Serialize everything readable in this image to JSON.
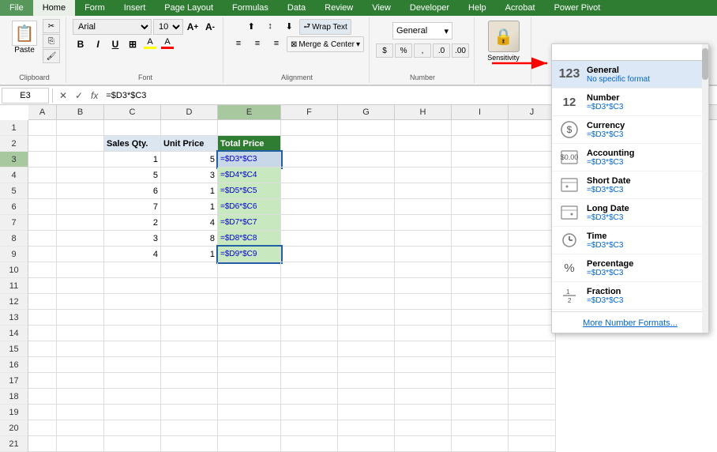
{
  "ribbon": {
    "tabs": [
      "File",
      "Home",
      "Form",
      "Insert",
      "Page Layout",
      "Formulas",
      "Data",
      "Review",
      "View",
      "Developer",
      "Help",
      "Acrobat",
      "Power Pivot"
    ],
    "active_tab": "Home",
    "groups": {
      "clipboard": {
        "label": "Clipboard",
        "paste_label": "Paste"
      },
      "font": {
        "label": "Font",
        "font_name": "Arial",
        "font_size": "10",
        "bold": "B",
        "italic": "I",
        "underline": "U"
      },
      "alignment": {
        "label": "Alignment",
        "wrap_text": "Wrap Text",
        "merge_center": "Merge & Center"
      },
      "number": {
        "label": "Number"
      },
      "sensitivity": {
        "label": "Sensitivity"
      }
    }
  },
  "formula_bar": {
    "cell_ref": "E3",
    "formula": "=$D3*$C3",
    "fx_label": "fx"
  },
  "spreadsheet": {
    "col_headers": [
      "A",
      "B",
      "C",
      "D",
      "E",
      "F",
      "G",
      "H",
      "I",
      "J"
    ],
    "rows": [
      {
        "num": 1,
        "cells": [
          "",
          "",
          "",
          "",
          "",
          "",
          "",
          "",
          "",
          ""
        ]
      },
      {
        "num": 2,
        "cells": [
          "",
          "",
          "Sales Qty.",
          "Unit Price",
          "Total Price",
          "",
          "",
          "",
          "",
          ""
        ]
      },
      {
        "num": 3,
        "cells": [
          "",
          "",
          "1",
          "5",
          "=$D3*$C3",
          "",
          "",
          "",
          "",
          ""
        ]
      },
      {
        "num": 4,
        "cells": [
          "",
          "",
          "5",
          "3",
          "=$D4*$C4",
          "",
          "",
          "",
          "",
          ""
        ]
      },
      {
        "num": 5,
        "cells": [
          "",
          "",
          "6",
          "1",
          "=$D5*$C5",
          "",
          "",
          "",
          "",
          ""
        ]
      },
      {
        "num": 6,
        "cells": [
          "",
          "",
          "7",
          "1",
          "=$D6*$C6",
          "",
          "",
          "",
          "",
          ""
        ]
      },
      {
        "num": 7,
        "cells": [
          "",
          "",
          "2",
          "4",
          "=$D7*$C7",
          "",
          "",
          "",
          "",
          ""
        ]
      },
      {
        "num": 8,
        "cells": [
          "",
          "",
          "3",
          "8",
          "=$D8*$C8",
          "",
          "",
          "",
          "",
          ""
        ]
      },
      {
        "num": 9,
        "cells": [
          "",
          "",
          "4",
          "1",
          "=$D9*$C9",
          "",
          "",
          "",
          "",
          ""
        ]
      },
      {
        "num": 10,
        "cells": [
          "",
          "",
          "",
          "",
          "",
          "",
          "",
          "",
          "",
          ""
        ]
      },
      {
        "num": 11,
        "cells": [
          "",
          "",
          "",
          "",
          "",
          "",
          "",
          "",
          "",
          ""
        ]
      },
      {
        "num": 12,
        "cells": [
          "",
          "",
          "",
          "",
          "",
          "",
          "",
          "",
          "",
          ""
        ]
      },
      {
        "num": 13,
        "cells": [
          "",
          "",
          "",
          "",
          "",
          "",
          "",
          "",
          "",
          ""
        ]
      },
      {
        "num": 14,
        "cells": [
          "",
          "",
          "",
          "",
          "",
          "",
          "",
          "",
          "",
          ""
        ]
      },
      {
        "num": 15,
        "cells": [
          "",
          "",
          "",
          "",
          "",
          "",
          "",
          "",
          "",
          ""
        ]
      },
      {
        "num": 16,
        "cells": [
          "",
          "",
          "",
          "",
          "",
          "",
          "",
          "",
          "",
          ""
        ]
      },
      {
        "num": 17,
        "cells": [
          "",
          "",
          "",
          "",
          "",
          "",
          "",
          "",
          "",
          ""
        ]
      },
      {
        "num": 18,
        "cells": [
          "",
          "",
          "",
          "",
          "",
          "",
          "",
          "",
          "",
          ""
        ]
      },
      {
        "num": 19,
        "cells": [
          "",
          "",
          "",
          "",
          "",
          "",
          "",
          "",
          "",
          ""
        ]
      },
      {
        "num": 20,
        "cells": [
          "",
          "",
          "",
          "",
          "",
          "",
          "",
          "",
          "",
          ""
        ]
      },
      {
        "num": 21,
        "cells": [
          "",
          "",
          "",
          "",
          "",
          "",
          "",
          "",
          "",
          ""
        ]
      }
    ]
  },
  "number_dropdown": {
    "search_placeholder": "",
    "items": [
      {
        "id": "general",
        "icon": "123",
        "label": "General",
        "sub": "No specific format",
        "active": true
      },
      {
        "id": "number",
        "icon": "12",
        "label": "Number",
        "sub": "=$D3*$C3",
        "active": false
      },
      {
        "id": "currency",
        "icon": "currency",
        "label": "Currency",
        "sub": "=$D3*$C3",
        "active": false
      },
      {
        "id": "accounting",
        "icon": "accounting",
        "label": "Accounting",
        "sub": "=$D3*$C3",
        "active": false
      },
      {
        "id": "short-date",
        "icon": "short-date",
        "label": "Short Date",
        "sub": "=$D3*$C3",
        "active": false
      },
      {
        "id": "long-date",
        "icon": "long-date",
        "label": "Long Date",
        "sub": "=$D3*$C3",
        "active": false
      },
      {
        "id": "time",
        "icon": "time",
        "label": "Time",
        "sub": "=$D3*$C3",
        "active": false
      },
      {
        "id": "percentage",
        "icon": "pct",
        "label": "Percentage",
        "sub": "=$D3*$C3",
        "active": false
      },
      {
        "id": "fraction",
        "icon": "frac",
        "label": "Fraction",
        "sub": "=$D3*$C3",
        "active": false
      }
    ],
    "more_label": "More Number Formats..."
  }
}
